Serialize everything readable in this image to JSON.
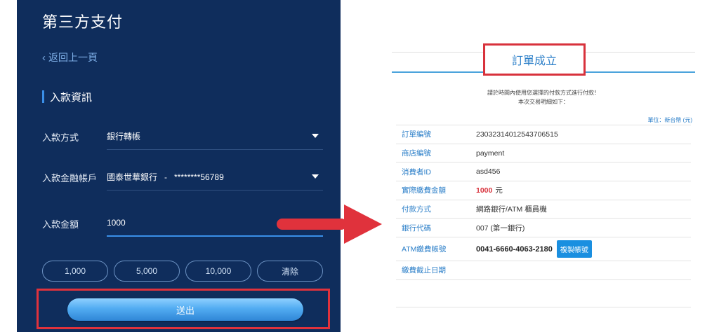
{
  "left": {
    "title": "第三方支付",
    "back_label": "返回上一頁",
    "section_title": "入款資訊",
    "method": {
      "label": "入款方式",
      "value": "銀行轉帳"
    },
    "account": {
      "label": "入款金融帳戶",
      "bank": "國泰世華銀行",
      "dash": "-",
      "number": "********56789"
    },
    "amount": {
      "label": "入款金額",
      "value": "1000"
    },
    "quick_amounts": [
      "1,000",
      "5,000",
      "10,000",
      "清除"
    ],
    "submit_label": "送出"
  },
  "right": {
    "order_title": "訂單成立",
    "notice_line1": "請於時間內使用您選擇的付款方式進行付款！",
    "notice_line2": "本次交易明細如下：",
    "unit": "單位：新台幣 (元)",
    "rows": [
      {
        "key": "訂單編號",
        "value": "23032314012543706515"
      },
      {
        "key": "商店編號",
        "value": "payment"
      },
      {
        "key": "消費者ID",
        "value": "asd456"
      },
      {
        "key": "實際繳費金額",
        "value": "1000",
        "suffix": "元"
      },
      {
        "key": "付款方式",
        "value": "網路銀行/ATM 櫃員機"
      },
      {
        "key": "銀行代碼",
        "value": "007 (第一銀行)"
      },
      {
        "key": "ATM繳費帳號",
        "value": "0041-6660-4063-2180",
        "button": "複製帳號"
      },
      {
        "key": "繳費截止日期",
        "value": ""
      }
    ]
  },
  "colors": {
    "panel_bg": "#0f2d5c",
    "accent_blue": "#3a8fe8",
    "highlight_red": "#e0323c",
    "link_blue": "#2a7ec8"
  }
}
